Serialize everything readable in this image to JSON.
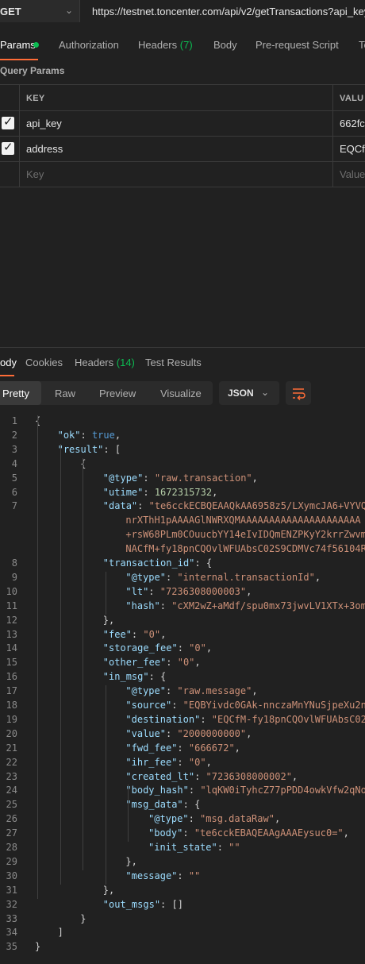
{
  "request": {
    "method": "GET",
    "url": "https://testnet.toncenter.com/api/v2/getTransactions?api_key"
  },
  "request_tabs": {
    "params": "Params",
    "authorization": "Authorization",
    "headers": "Headers",
    "headers_count": "(7)",
    "body": "Body",
    "pre_request_script": "Pre-request Script",
    "tests_partial": "Te"
  },
  "query_params": {
    "title": "Query Params",
    "key_header": "KEY",
    "value_header": "VALU",
    "rows": [
      {
        "key": "api_key",
        "value": "662fc",
        "checked": true
      },
      {
        "key": "address",
        "value": "EQCfI",
        "checked": true
      }
    ],
    "placeholder_key": "Key",
    "placeholder_value": "Value"
  },
  "response_tabs": {
    "body_partial": "ody",
    "cookies": "Cookies",
    "headers": "Headers",
    "headers_count": "(14)",
    "test_results": "Test Results"
  },
  "format": {
    "pretty": "Pretty",
    "raw": "Raw",
    "preview": "Preview",
    "visualize": "Visualize",
    "json": "JSON"
  },
  "code_lines": [
    {
      "n": 1,
      "indent": 0,
      "tokens": [
        [
          "p",
          "{"
        ]
      ]
    },
    {
      "n": 2,
      "indent": 1,
      "tokens": [
        [
          "k",
          "\"ok\""
        ],
        [
          "p",
          ": "
        ],
        [
          "l",
          "true"
        ],
        [
          "p",
          ","
        ]
      ]
    },
    {
      "n": 3,
      "indent": 1,
      "tokens": [
        [
          "k",
          "\"result\""
        ],
        [
          "p",
          ": ["
        ]
      ]
    },
    {
      "n": 4,
      "indent": 2,
      "tokens": [
        [
          "p",
          "{"
        ]
      ]
    },
    {
      "n": 5,
      "indent": 3,
      "tokens": [
        [
          "k",
          "\"@type\""
        ],
        [
          "p",
          ": "
        ],
        [
          "s",
          "\"raw.transaction\""
        ],
        [
          "p",
          ","
        ]
      ]
    },
    {
      "n": 6,
      "indent": 3,
      "tokens": [
        [
          "k",
          "\"utime\""
        ],
        [
          "p",
          ": "
        ],
        [
          "n",
          "1672315732"
        ],
        [
          "p",
          ","
        ]
      ]
    },
    {
      "n": 7,
      "indent": 3,
      "tokens": [
        [
          "k",
          "\"data\""
        ],
        [
          "p",
          ": "
        ],
        [
          "s",
          "\"te6cckECBQEAAQkAA6958z5/LXymcJA6+VYVQ"
        ]
      ]
    },
    {
      "n": null,
      "indent": 4,
      "tokens": [
        [
          "s",
          "nrXThH1pAAAAGlNWRXQMAAAAAAAAAAAAAAAAAAAAA"
        ]
      ]
    },
    {
      "n": null,
      "indent": 4,
      "tokens": [
        [
          "s",
          "+rsW68PLm0COuucbYY14eIvIDQmENZPKyY2krrZwvm"
        ]
      ]
    },
    {
      "n": null,
      "indent": 4,
      "tokens": [
        [
          "s",
          "NACfM+fy18pnCQOvlWFUAbsC02S9CDMVc74f56104R"
        ]
      ]
    },
    {
      "n": 8,
      "indent": 3,
      "tokens": [
        [
          "k",
          "\"transaction_id\""
        ],
        [
          "p",
          ": {"
        ]
      ]
    },
    {
      "n": 9,
      "indent": 4,
      "tokens": [
        [
          "k",
          "\"@type\""
        ],
        [
          "p",
          ": "
        ],
        [
          "s",
          "\"internal.transactionId\""
        ],
        [
          "p",
          ","
        ]
      ]
    },
    {
      "n": 10,
      "indent": 4,
      "tokens": [
        [
          "k",
          "\"lt\""
        ],
        [
          "p",
          ": "
        ],
        [
          "s",
          "\"7236308000003\""
        ],
        [
          "p",
          ","
        ]
      ]
    },
    {
      "n": 11,
      "indent": 4,
      "tokens": [
        [
          "k",
          "\"hash\""
        ],
        [
          "p",
          ": "
        ],
        [
          "s",
          "\"cXM2wZ+aMdf/spu0mx73jwvLV1XTx+3om"
        ]
      ]
    },
    {
      "n": 12,
      "indent": 3,
      "tokens": [
        [
          "p",
          "},"
        ]
      ]
    },
    {
      "n": 13,
      "indent": 3,
      "tokens": [
        [
          "k",
          "\"fee\""
        ],
        [
          "p",
          ": "
        ],
        [
          "s",
          "\"0\""
        ],
        [
          "p",
          ","
        ]
      ]
    },
    {
      "n": 14,
      "indent": 3,
      "tokens": [
        [
          "k",
          "\"storage_fee\""
        ],
        [
          "p",
          ": "
        ],
        [
          "s",
          "\"0\""
        ],
        [
          "p",
          ","
        ]
      ]
    },
    {
      "n": 15,
      "indent": 3,
      "tokens": [
        [
          "k",
          "\"other_fee\""
        ],
        [
          "p",
          ": "
        ],
        [
          "s",
          "\"0\""
        ],
        [
          "p",
          ","
        ]
      ]
    },
    {
      "n": 16,
      "indent": 3,
      "tokens": [
        [
          "k",
          "\"in_msg\""
        ],
        [
          "p",
          ": {"
        ]
      ]
    },
    {
      "n": 17,
      "indent": 4,
      "tokens": [
        [
          "k",
          "\"@type\""
        ],
        [
          "p",
          ": "
        ],
        [
          "s",
          "\"raw.message\""
        ],
        [
          "p",
          ","
        ]
      ]
    },
    {
      "n": 18,
      "indent": 4,
      "tokens": [
        [
          "k",
          "\"source\""
        ],
        [
          "p",
          ": "
        ],
        [
          "s",
          "\"EQBYivdc0GAk-nnczaMnYNuSjpeXu2n"
        ]
      ]
    },
    {
      "n": 19,
      "indent": 4,
      "tokens": [
        [
          "k",
          "\"destination\""
        ],
        [
          "p",
          ": "
        ],
        [
          "s",
          "\"EQCfM-fy18pnCQOvlWFUAbsC02"
        ]
      ]
    },
    {
      "n": 20,
      "indent": 4,
      "tokens": [
        [
          "k",
          "\"value\""
        ],
        [
          "p",
          ": "
        ],
        [
          "s",
          "\"2000000000\""
        ],
        [
          "p",
          ","
        ]
      ]
    },
    {
      "n": 21,
      "indent": 4,
      "tokens": [
        [
          "k",
          "\"fwd_fee\""
        ],
        [
          "p",
          ": "
        ],
        [
          "s",
          "\"666672\""
        ],
        [
          "p",
          ","
        ]
      ]
    },
    {
      "n": 22,
      "indent": 4,
      "tokens": [
        [
          "k",
          "\"ihr_fee\""
        ],
        [
          "p",
          ": "
        ],
        [
          "s",
          "\"0\""
        ],
        [
          "p",
          ","
        ]
      ]
    },
    {
      "n": 23,
      "indent": 4,
      "tokens": [
        [
          "k",
          "\"created_lt\""
        ],
        [
          "p",
          ": "
        ],
        [
          "s",
          "\"7236308000002\""
        ],
        [
          "p",
          ","
        ]
      ]
    },
    {
      "n": 24,
      "indent": 4,
      "tokens": [
        [
          "k",
          "\"body_hash\""
        ],
        [
          "p",
          ": "
        ],
        [
          "s",
          "\"lqKW0iTyhcZ77pPDD4owkVfw2qNo"
        ]
      ]
    },
    {
      "n": 25,
      "indent": 4,
      "tokens": [
        [
          "k",
          "\"msg_data\""
        ],
        [
          "p",
          ": {"
        ]
      ]
    },
    {
      "n": 26,
      "indent": 5,
      "tokens": [
        [
          "k",
          "\"@type\""
        ],
        [
          "p",
          ": "
        ],
        [
          "s",
          "\"msg.dataRaw\""
        ],
        [
          "p",
          ","
        ]
      ]
    },
    {
      "n": 27,
      "indent": 5,
      "tokens": [
        [
          "k",
          "\"body\""
        ],
        [
          "p",
          ": "
        ],
        [
          "s",
          "\"te6cckEBAQEAAgAAAEysuc0=\""
        ],
        [
          "p",
          ","
        ]
      ]
    },
    {
      "n": 28,
      "indent": 5,
      "tokens": [
        [
          "k",
          "\"init_state\""
        ],
        [
          "p",
          ": "
        ],
        [
          "s",
          "\"\""
        ]
      ]
    },
    {
      "n": 29,
      "indent": 4,
      "tokens": [
        [
          "p",
          "},"
        ]
      ]
    },
    {
      "n": 30,
      "indent": 4,
      "tokens": [
        [
          "k",
          "\"message\""
        ],
        [
          "p",
          ": "
        ],
        [
          "s",
          "\"\""
        ]
      ]
    },
    {
      "n": 31,
      "indent": 3,
      "tokens": [
        [
          "p",
          "},"
        ]
      ]
    },
    {
      "n": 32,
      "indent": 3,
      "tokens": [
        [
          "k",
          "\"out_msgs\""
        ],
        [
          "p",
          ": []"
        ]
      ]
    },
    {
      "n": 33,
      "indent": 2,
      "tokens": [
        [
          "p",
          "}"
        ]
      ]
    },
    {
      "n": 34,
      "indent": 1,
      "tokens": [
        [
          "p",
          "]"
        ]
      ]
    },
    {
      "n": 35,
      "indent": 0,
      "tokens": [
        [
          "p",
          "}"
        ]
      ]
    }
  ]
}
